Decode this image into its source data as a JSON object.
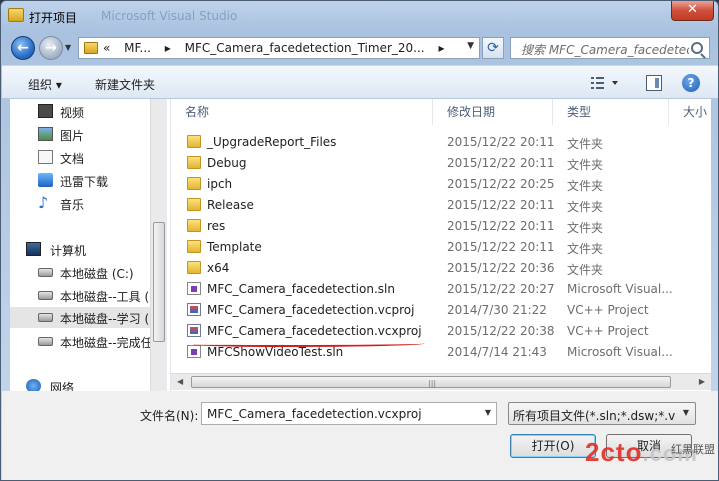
{
  "window": {
    "title": "打开项目",
    "ghost_title": "Microsoft Visual Studio",
    "close_label": "✕"
  },
  "nav": {
    "path": [
      "MF...",
      "MFC_Camera_facedetection_Timer_20..."
    ],
    "search_placeholder": "搜索 MFC_Camera_facedetection..."
  },
  "toolbar": {
    "organize": "组织 ▾",
    "new_folder": "新建文件夹",
    "help": "?"
  },
  "sidebar": {
    "items": [
      {
        "label": "视频",
        "icon": "video-icon"
      },
      {
        "label": "图片",
        "icon": "picture-icon"
      },
      {
        "label": "文档",
        "icon": "document-icon"
      },
      {
        "label": "迅雷下载",
        "icon": "download-icon"
      },
      {
        "label": "音乐",
        "icon": "music-icon"
      },
      {
        "label": "计算机",
        "icon": "computer-icon"
      },
      {
        "label": "本地磁盘 (C:)",
        "icon": "drive-icon"
      },
      {
        "label": "本地磁盘--工具 (",
        "icon": "drive-icon"
      },
      {
        "label": "本地磁盘--学习 (",
        "icon": "drive-icon"
      },
      {
        "label": "本地磁盘--完成任",
        "icon": "drive-icon"
      },
      {
        "label": "网络",
        "icon": "network-icon"
      }
    ]
  },
  "columns": {
    "name": "名称",
    "date": "修改日期",
    "type": "类型",
    "size": "大小"
  },
  "files": [
    {
      "name": "_UpgradeReport_Files",
      "date": "2015/12/22 20:11",
      "type": "文件夹",
      "icon": "folder"
    },
    {
      "name": "Debug",
      "date": "2015/12/22 20:11",
      "type": "文件夹",
      "icon": "folder"
    },
    {
      "name": "ipch",
      "date": "2015/12/22 20:25",
      "type": "文件夹",
      "icon": "folder"
    },
    {
      "name": "Release",
      "date": "2015/12/22 20:11",
      "type": "文件夹",
      "icon": "folder"
    },
    {
      "name": "res",
      "date": "2015/12/22 20:11",
      "type": "文件夹",
      "icon": "folder"
    },
    {
      "name": "Template",
      "date": "2015/12/22 20:11",
      "type": "文件夹",
      "icon": "folder"
    },
    {
      "name": "x64",
      "date": "2015/12/22 20:36",
      "type": "文件夹",
      "icon": "folder"
    },
    {
      "name": "MFC_Camera_facedetection.sln",
      "date": "2015/12/22 20:27",
      "type": "Microsoft Visual...",
      "icon": "sln"
    },
    {
      "name": "MFC_Camera_facedetection.vcproj",
      "date": "2014/7/30 21:22",
      "type": "VC++ Project",
      "icon": "vc"
    },
    {
      "name": "MFC_Camera_facedetection.vcxproj",
      "date": "2015/12/22 20:38",
      "type": "VC++ Project",
      "icon": "vc"
    },
    {
      "name": "MFCShowVideoTest.sln",
      "date": "2014/7/14 21:43",
      "type": "Microsoft Visual...",
      "icon": "sln"
    }
  ],
  "bottom": {
    "filename_label": "文件名(N):",
    "filename_value": "MFC_Camera_facedetection.vcxproj",
    "filetype_value": "所有项目文件(*.sln;*.dsw;*.vcw",
    "open_label": "打开(O)",
    "cancel_label": "取消"
  },
  "watermark": {
    "text": "2cto",
    "suffix": ".com",
    "cn": "红黑联盟"
  },
  "accent": {
    "annotation_underline": "#d41b1b"
  }
}
